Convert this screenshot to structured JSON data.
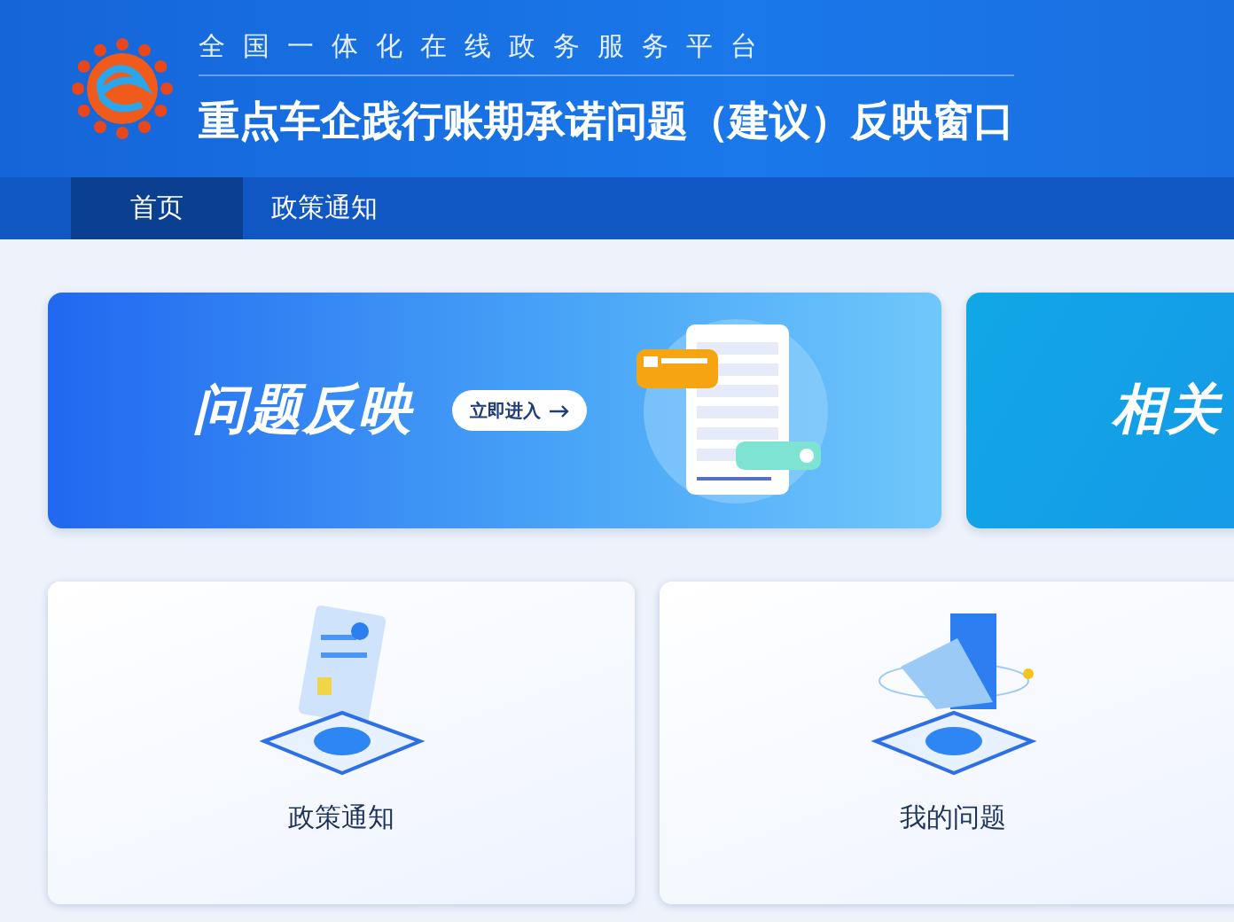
{
  "header": {
    "platform": "全国一体化在线政务服务平台",
    "title": "重点车企践行账期承诺问题（建议）反映窗口"
  },
  "nav": [
    {
      "label": "首页",
      "selected": true
    },
    {
      "label": "政策通知",
      "selected": false
    }
  ],
  "banners": [
    {
      "kind": "feedback",
      "title": "问题反映",
      "button": "立即进入"
    },
    {
      "kind": "related",
      "title": "相关"
    }
  ],
  "cards": [
    {
      "kind": "policy",
      "label": "政策通知"
    },
    {
      "kind": "questions",
      "label": "我的问题"
    }
  ]
}
